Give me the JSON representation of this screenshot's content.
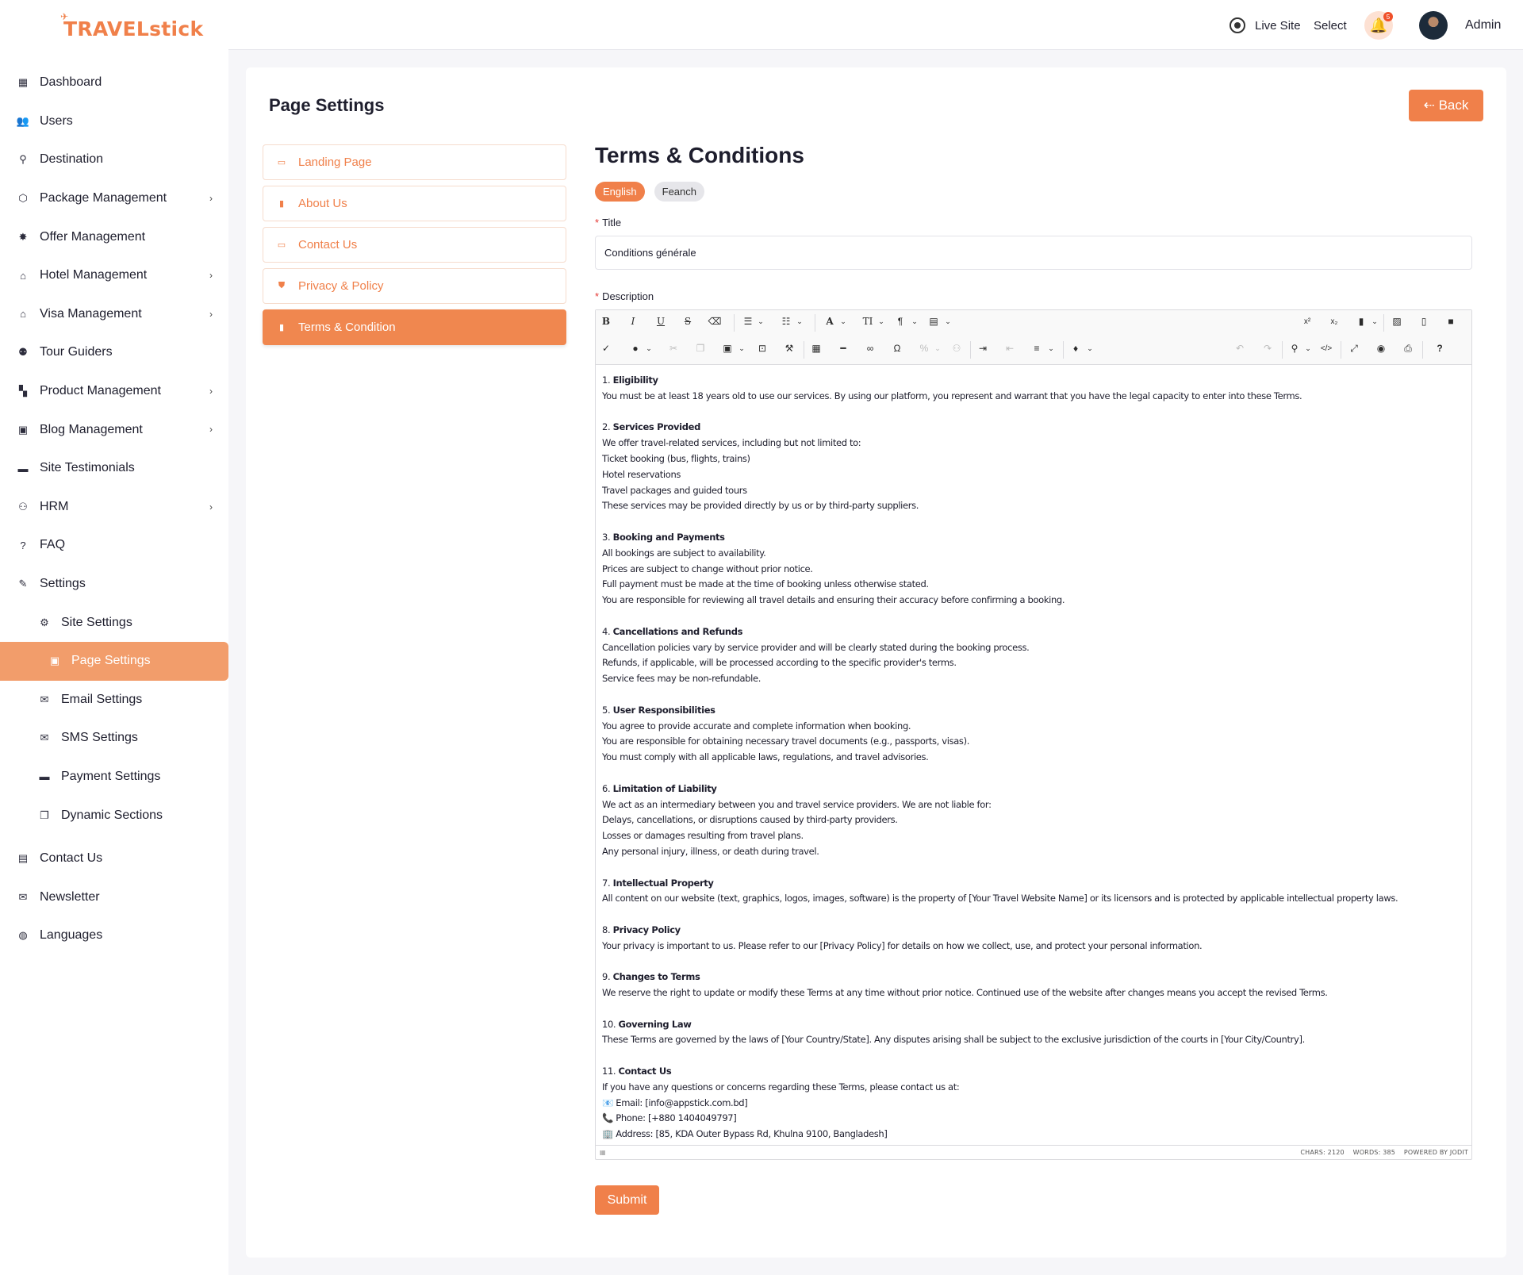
{
  "brand": {
    "logo_text": "TRAVELstick",
    "accent_color": "#f0804a"
  },
  "sidebar": {
    "items": [
      {
        "label": "Dashboard",
        "icon": "dashboard-icon",
        "glyph": "▦"
      },
      {
        "label": "Users",
        "icon": "users-icon",
        "glyph": "👥"
      },
      {
        "label": "Destination",
        "icon": "destination-icon",
        "glyph": "⚲"
      },
      {
        "label": "Package Management",
        "icon": "package-icon",
        "glyph": "⬡"
      },
      {
        "label": "Offer Management",
        "icon": "offer-icon",
        "glyph": "✸"
      },
      {
        "label": "Hotel Management",
        "icon": "hotel-icon",
        "glyph": "⌂"
      },
      {
        "label": "Visa Management",
        "icon": "visa-icon",
        "glyph": "⌂"
      },
      {
        "label": "Tour Guiders",
        "icon": "tour-guide-icon",
        "glyph": "⚉"
      },
      {
        "label": "Product Management",
        "icon": "product-icon",
        "glyph": "▚"
      },
      {
        "label": "Blog Management",
        "icon": "blog-icon",
        "glyph": "▣"
      },
      {
        "label": "Site Testimonials",
        "icon": "testimonial-icon",
        "glyph": "▬"
      },
      {
        "label": "HRM",
        "icon": "hrm-icon",
        "glyph": "⚇"
      },
      {
        "label": "FAQ",
        "icon": "faq-icon",
        "glyph": "?"
      },
      {
        "label": "Settings",
        "icon": "wrench-icon",
        "glyph": "✎"
      },
      {
        "label": "Site Settings",
        "icon": "gear-icon",
        "glyph": "⚙"
      },
      {
        "label": "Page Settings",
        "icon": "page-icon",
        "glyph": "▣"
      },
      {
        "label": "Email Settings",
        "icon": "email-icon",
        "glyph": "✉"
      },
      {
        "label": "SMS Settings",
        "icon": "sms-icon",
        "glyph": "✉"
      },
      {
        "label": "Payment Settings",
        "icon": "payment-icon",
        "glyph": "▬"
      },
      {
        "label": "Dynamic Sections",
        "icon": "sections-icon",
        "glyph": "❐"
      },
      {
        "label": "Contact Us",
        "icon": "contact-icon",
        "glyph": "▤"
      },
      {
        "label": "Newsletter",
        "icon": "newsletter-icon",
        "glyph": "✉"
      },
      {
        "label": "Languages",
        "icon": "globe-icon",
        "glyph": "◍"
      }
    ]
  },
  "header": {
    "live_site": "Live Site",
    "select": "Select",
    "notification_count": "5",
    "user_name": "Admin"
  },
  "page": {
    "title": "Page Settings",
    "back_label": "⇠ Back",
    "pages": [
      {
        "label": "Landing Page",
        "icon": "image-icon",
        "glyph": "▭"
      },
      {
        "label": "About Us",
        "icon": "document-icon",
        "glyph": "▮"
      },
      {
        "label": "Contact Us",
        "icon": "contact-card-icon",
        "glyph": "▭"
      },
      {
        "label": "Privacy & Policy",
        "icon": "shield-icon",
        "glyph": "⛊"
      },
      {
        "label": "Terms & Condition",
        "icon": "document-icon",
        "glyph": "▮"
      }
    ]
  },
  "form": {
    "section_title": "Terms & Conditions",
    "languages": [
      "English",
      "Feanch"
    ],
    "title_label": "Title",
    "title_value": "Conditions générale",
    "description_label": "Description",
    "submit_label": "Submit"
  },
  "editor": {
    "paragraphs": [
      {
        "num": "1. ",
        "head": "Eligibility",
        "lines": [
          "You must be at least 18 years old to use our services. By using our platform, you represent and warrant that you have the legal capacity to enter into these Terms."
        ]
      },
      {
        "num": "2. ",
        "head": "Services Provided",
        "lines": [
          "We offer travel-related services, including but not limited to:",
          "Ticket booking (bus, flights, trains)",
          "Hotel reservations",
          "Travel packages and guided tours",
          "These services may be provided directly by us or by third-party suppliers."
        ]
      },
      {
        "num": "3. ",
        "head": "Booking and Payments",
        "lines": [
          "All bookings are subject to availability.",
          "Prices are subject to change without prior notice.",
          "Full payment must be made at the time of booking unless otherwise stated.",
          "You are responsible for reviewing all travel details and ensuring their accuracy before confirming a booking."
        ]
      },
      {
        "num": "4. ",
        "head": "Cancellations and Refunds",
        "lines": [
          "Cancellation policies vary by service provider and will be clearly stated during the booking process.",
          "Refunds, if applicable, will be processed according to the specific provider's terms.",
          "Service fees may be non-refundable."
        ]
      },
      {
        "num": "5. ",
        "head": "User Responsibilities",
        "lines": [
          "You agree to provide accurate and complete information when booking.",
          "You are responsible for obtaining necessary travel documents (e.g., passports, visas).",
          "You must comply with all applicable laws, regulations, and travel advisories."
        ]
      },
      {
        "num": "6. ",
        "head": "Limitation of Liability",
        "lines": [
          "We act as an intermediary between you and travel service providers. We are not liable for:",
          "Delays, cancellations, or disruptions caused by third-party providers.",
          "Losses or damages resulting from travel plans.",
          "Any personal injury, illness, or death during travel."
        ]
      },
      {
        "num": "7. ",
        "head": "Intellectual Property",
        "lines": [
          "All content on our website (text, graphics, logos, images, software) is the property of [Your Travel Website Name] or its licensors and is protected by applicable intellectual property laws."
        ]
      },
      {
        "num": "8. ",
        "head": "Privacy Policy",
        "lines": [
          "Your privacy is important to us. Please refer to our [Privacy Policy] for details on how we collect, use, and protect your personal information."
        ]
      },
      {
        "num": "9. ",
        "head": "Changes to Terms",
        "lines": [
          "We reserve the right to update or modify these Terms at any time without prior notice. Continued use of the website after changes means you accept the revised Terms."
        ]
      },
      {
        "num": "10. ",
        "head": "Governing Law",
        "lines": [
          "These Terms are governed by the laws of [Your Country/State]. Any disputes arising shall be subject to the exclusive jurisdiction of the courts in [Your City/Country]."
        ]
      },
      {
        "num": "11. ",
        "head": "Contact Us",
        "lines": [
          "If you have any questions or concerns regarding these Terms, please contact us at:",
          "📧 Email: [info@appstick.com.bd]",
          "📞 Phone: [+880 1404049797]",
          "🏢 Address: [85, KDA Outer Bypass Rd, Khulna 9100, Bangladesh]"
        ]
      }
    ],
    "chars": "CHARS: 2120",
    "words": "WORDS: 385",
    "powered": "POWERED BY JODIT"
  }
}
